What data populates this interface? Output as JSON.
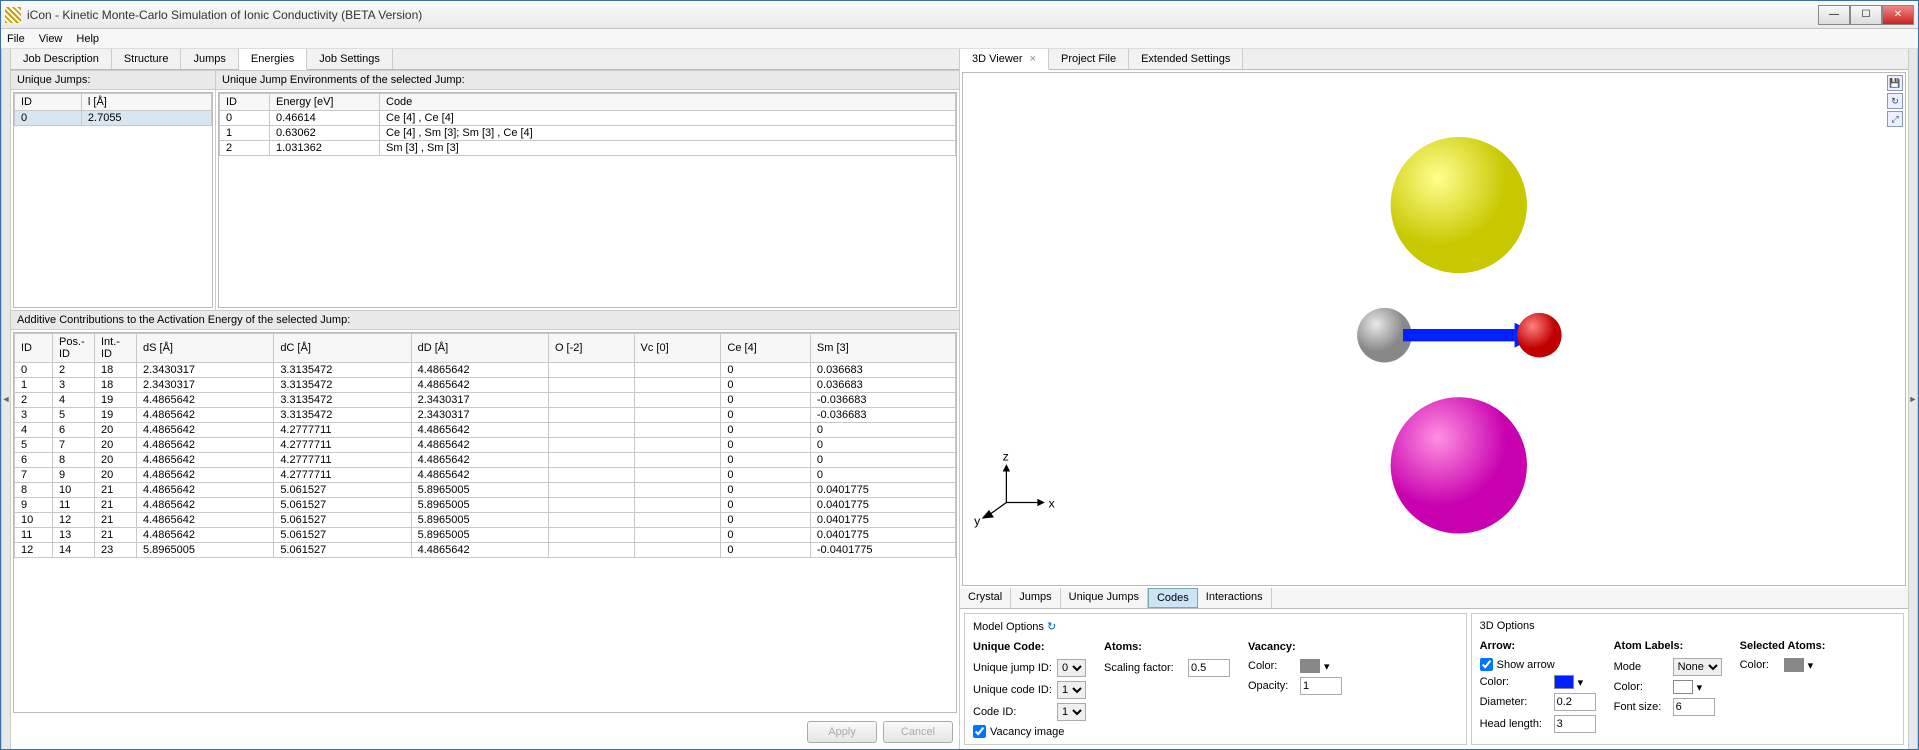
{
  "window": {
    "title": "iCon - Kinetic Monte-Carlo Simulation of Ionic Conductivity (BETA Version)"
  },
  "menubar": {
    "file": "File",
    "view": "View",
    "help": "Help"
  },
  "main_tabs": {
    "job_description": "Job Description",
    "structure": "Structure",
    "jumps": "Jumps",
    "energies": "Energies",
    "job_settings": "Job Settings"
  },
  "left": {
    "unique_jumps_label": "Unique Jumps:",
    "unique_jumps_cols": {
      "id": "ID",
      "l": "l [Å]"
    },
    "unique_jumps_rows": [
      {
        "id": "0",
        "l": "2.7055"
      }
    ],
    "env_label": "Unique Jump Environments of the selected Jump:",
    "env_cols": {
      "id": "ID",
      "energy": "Energy [eV]",
      "code": "Code"
    },
    "env_rows": [
      {
        "id": "0",
        "energy": "0.46614",
        "code": "Ce [4] , Ce [4]"
      },
      {
        "id": "1",
        "energy": "0.63062",
        "code": "Ce [4] , Sm [3]; Sm [3] , Ce [4]"
      },
      {
        "id": "2",
        "energy": "1.031362",
        "code": "Sm [3] , Sm [3]"
      }
    ],
    "additive_label": "Additive Contributions to the Activation Energy of the selected Jump:",
    "additive_cols": {
      "id": "ID",
      "posid": "Pos.-ID",
      "intid": "Int.-ID",
      "ds": "dS [Å]",
      "dc": "dC [Å]",
      "dd": "dD [Å]",
      "o": "O [-2]",
      "vc": "Vc [0]",
      "ce": "Ce [4]",
      "sm": "Sm [3]"
    },
    "additive_rows": [
      {
        "id": "0",
        "posid": "2",
        "intid": "18",
        "ds": "2.3430317",
        "dc": "3.3135472",
        "dd": "4.4865642",
        "o": "",
        "vc": "",
        "ce": "0",
        "sm": "0.036683"
      },
      {
        "id": "1",
        "posid": "3",
        "intid": "18",
        "ds": "2.3430317",
        "dc": "3.3135472",
        "dd": "4.4865642",
        "o": "",
        "vc": "",
        "ce": "0",
        "sm": "0.036683"
      },
      {
        "id": "2",
        "posid": "4",
        "intid": "19",
        "ds": "4.4865642",
        "dc": "3.3135472",
        "dd": "2.3430317",
        "o": "",
        "vc": "",
        "ce": "0",
        "sm": "-0.036683"
      },
      {
        "id": "3",
        "posid": "5",
        "intid": "19",
        "ds": "4.4865642",
        "dc": "3.3135472",
        "dd": "2.3430317",
        "o": "",
        "vc": "",
        "ce": "0",
        "sm": "-0.036683"
      },
      {
        "id": "4",
        "posid": "6",
        "intid": "20",
        "ds": "4.4865642",
        "dc": "4.2777711",
        "dd": "4.4865642",
        "o": "",
        "vc": "",
        "ce": "0",
        "sm": "0"
      },
      {
        "id": "5",
        "posid": "7",
        "intid": "20",
        "ds": "4.4865642",
        "dc": "4.2777711",
        "dd": "4.4865642",
        "o": "",
        "vc": "",
        "ce": "0",
        "sm": "0"
      },
      {
        "id": "6",
        "posid": "8",
        "intid": "20",
        "ds": "4.4865642",
        "dc": "4.2777711",
        "dd": "4.4865642",
        "o": "",
        "vc": "",
        "ce": "0",
        "sm": "0"
      },
      {
        "id": "7",
        "posid": "9",
        "intid": "20",
        "ds": "4.4865642",
        "dc": "4.2777711",
        "dd": "4.4865642",
        "o": "",
        "vc": "",
        "ce": "0",
        "sm": "0"
      },
      {
        "id": "8",
        "posid": "10",
        "intid": "21",
        "ds": "4.4865642",
        "dc": "5.061527",
        "dd": "5.8965005",
        "o": "",
        "vc": "",
        "ce": "0",
        "sm": "0.0401775"
      },
      {
        "id": "9",
        "posid": "11",
        "intid": "21",
        "ds": "4.4865642",
        "dc": "5.061527",
        "dd": "5.8965005",
        "o": "",
        "vc": "",
        "ce": "0",
        "sm": "0.0401775"
      },
      {
        "id": "10",
        "posid": "12",
        "intid": "21",
        "ds": "4.4865642",
        "dc": "5.061527",
        "dd": "5.8965005",
        "o": "",
        "vc": "",
        "ce": "0",
        "sm": "0.0401775"
      },
      {
        "id": "11",
        "posid": "13",
        "intid": "21",
        "ds": "4.4865642",
        "dc": "5.061527",
        "dd": "5.8965005",
        "o": "",
        "vc": "",
        "ce": "0",
        "sm": "0.0401775"
      },
      {
        "id": "12",
        "posid": "14",
        "intid": "23",
        "ds": "5.8965005",
        "dc": "5.061527",
        "dd": "4.4865642",
        "o": "",
        "vc": "",
        "ce": "0",
        "sm": "-0.0401775"
      }
    ],
    "apply": "Apply",
    "cancel": "Cancel"
  },
  "right_tabs": {
    "viewer": "3D Viewer",
    "project": "Project File",
    "extended": "Extended Settings"
  },
  "subtabs": {
    "crystal": "Crystal",
    "jumps": "Jumps",
    "unique_jumps": "Unique Jumps",
    "codes": "Codes",
    "interactions": "Interactions"
  },
  "opts": {
    "model_legend": "Model Options",
    "unique_code": "Unique Code:",
    "unique_jump_id": "Unique jump ID:",
    "unique_jump_id_val": "0",
    "unique_code_id": "Unique code ID:",
    "unique_code_id_val": "1",
    "code_id": "Code ID:",
    "code_id_val": "1",
    "vacancy_image": "Vacancy image",
    "atoms": "Atoms:",
    "scaling_factor": "Scaling factor:",
    "scaling_factor_val": "0.5",
    "vacancy": "Vacancy:",
    "vac_color": "Color:",
    "opacity": "Opacity:",
    "opacity_val": "1",
    "threed_legend": "3D Options",
    "arrow": "Arrow:",
    "show_arrow": "Show arrow",
    "arrow_color": "Color:",
    "diameter": "Diameter:",
    "diameter_val": "0.2",
    "head_length": "Head length:",
    "head_length_val": "3",
    "atom_labels": "Atom Labels:",
    "mode": "Mode",
    "mode_val": "None",
    "al_color": "Color:",
    "font_size": "Font size:",
    "font_size_val": "6",
    "selected_atoms": "Selected Atoms:",
    "sa_color": "Color:"
  },
  "axis": {
    "z": "z",
    "y": "y",
    "x": "x"
  }
}
